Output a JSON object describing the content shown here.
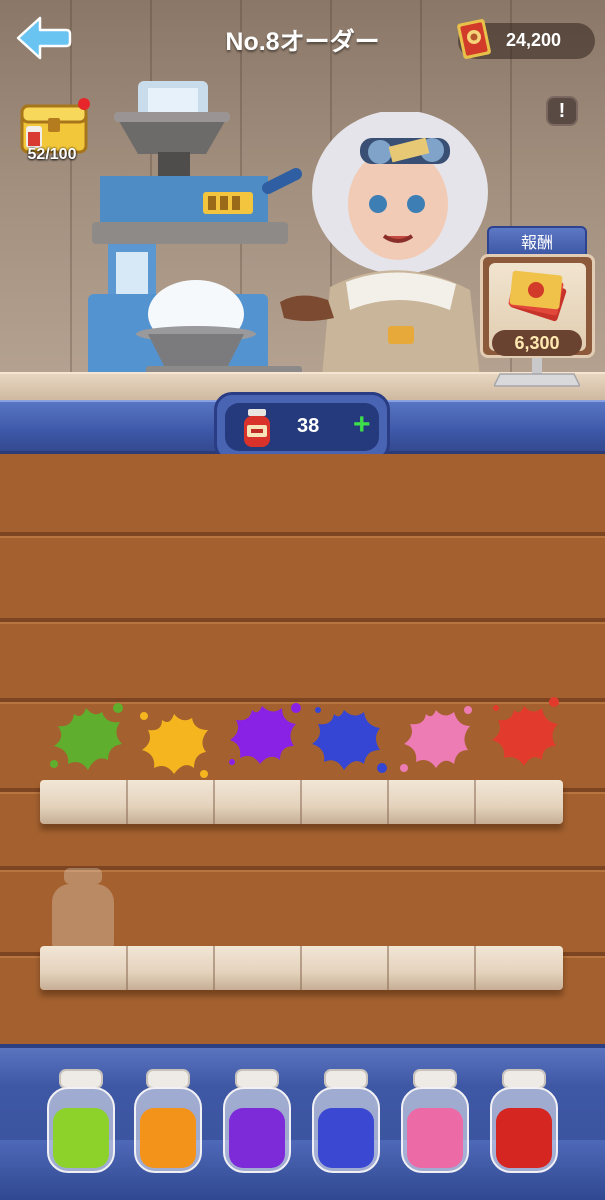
{
  "header": {
    "title": "No.8オーダー",
    "currency_value": "24,200"
  },
  "chest": {
    "count": "52/100"
  },
  "info_button": {
    "label": "!"
  },
  "reward": {
    "heading": "報酬",
    "value": "6,300"
  },
  "jar_counter": {
    "value": "38",
    "plus_label": "+"
  },
  "paint_splats": [
    {
      "color": "#5fae2e",
      "name": "green"
    },
    {
      "color": "#f5b51e",
      "name": "yellow"
    },
    {
      "color": "#8a22e6",
      "name": "purple"
    },
    {
      "color": "#3546d4",
      "name": "blue"
    },
    {
      "color": "#ee7cb4",
      "name": "pink"
    },
    {
      "color": "#e23a2c",
      "name": "red"
    }
  ],
  "paint_jars": [
    {
      "color": "#8dd22a",
      "name": "green"
    },
    {
      "color": "#f3931a",
      "name": "orange"
    },
    {
      "color": "#7d2ad8",
      "name": "purple"
    },
    {
      "color": "#3a48d2",
      "name": "blue"
    },
    {
      "color": "#ec6aa6",
      "name": "pink"
    },
    {
      "color": "#d62622",
      "name": "red"
    }
  ]
}
